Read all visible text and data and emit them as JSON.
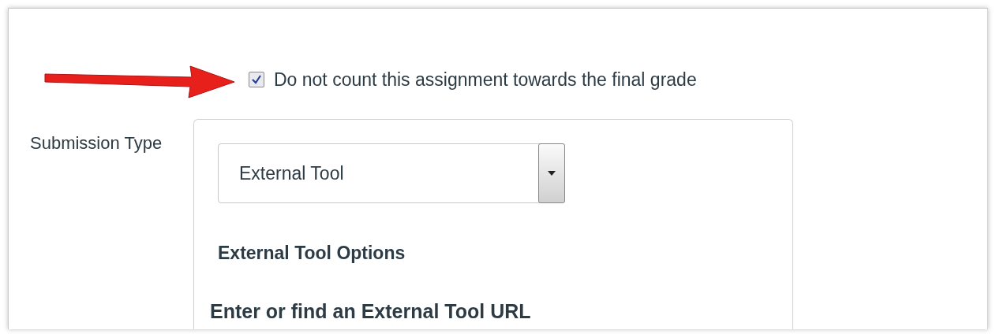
{
  "grade_option": {
    "label": "Do not count this assignment towards the final grade",
    "checked": true
  },
  "submission_type": {
    "label": "Submission Type",
    "select": {
      "value": "External Tool"
    },
    "options_heading": "External Tool Options",
    "url_heading": "Enter or find an External Tool URL"
  }
}
